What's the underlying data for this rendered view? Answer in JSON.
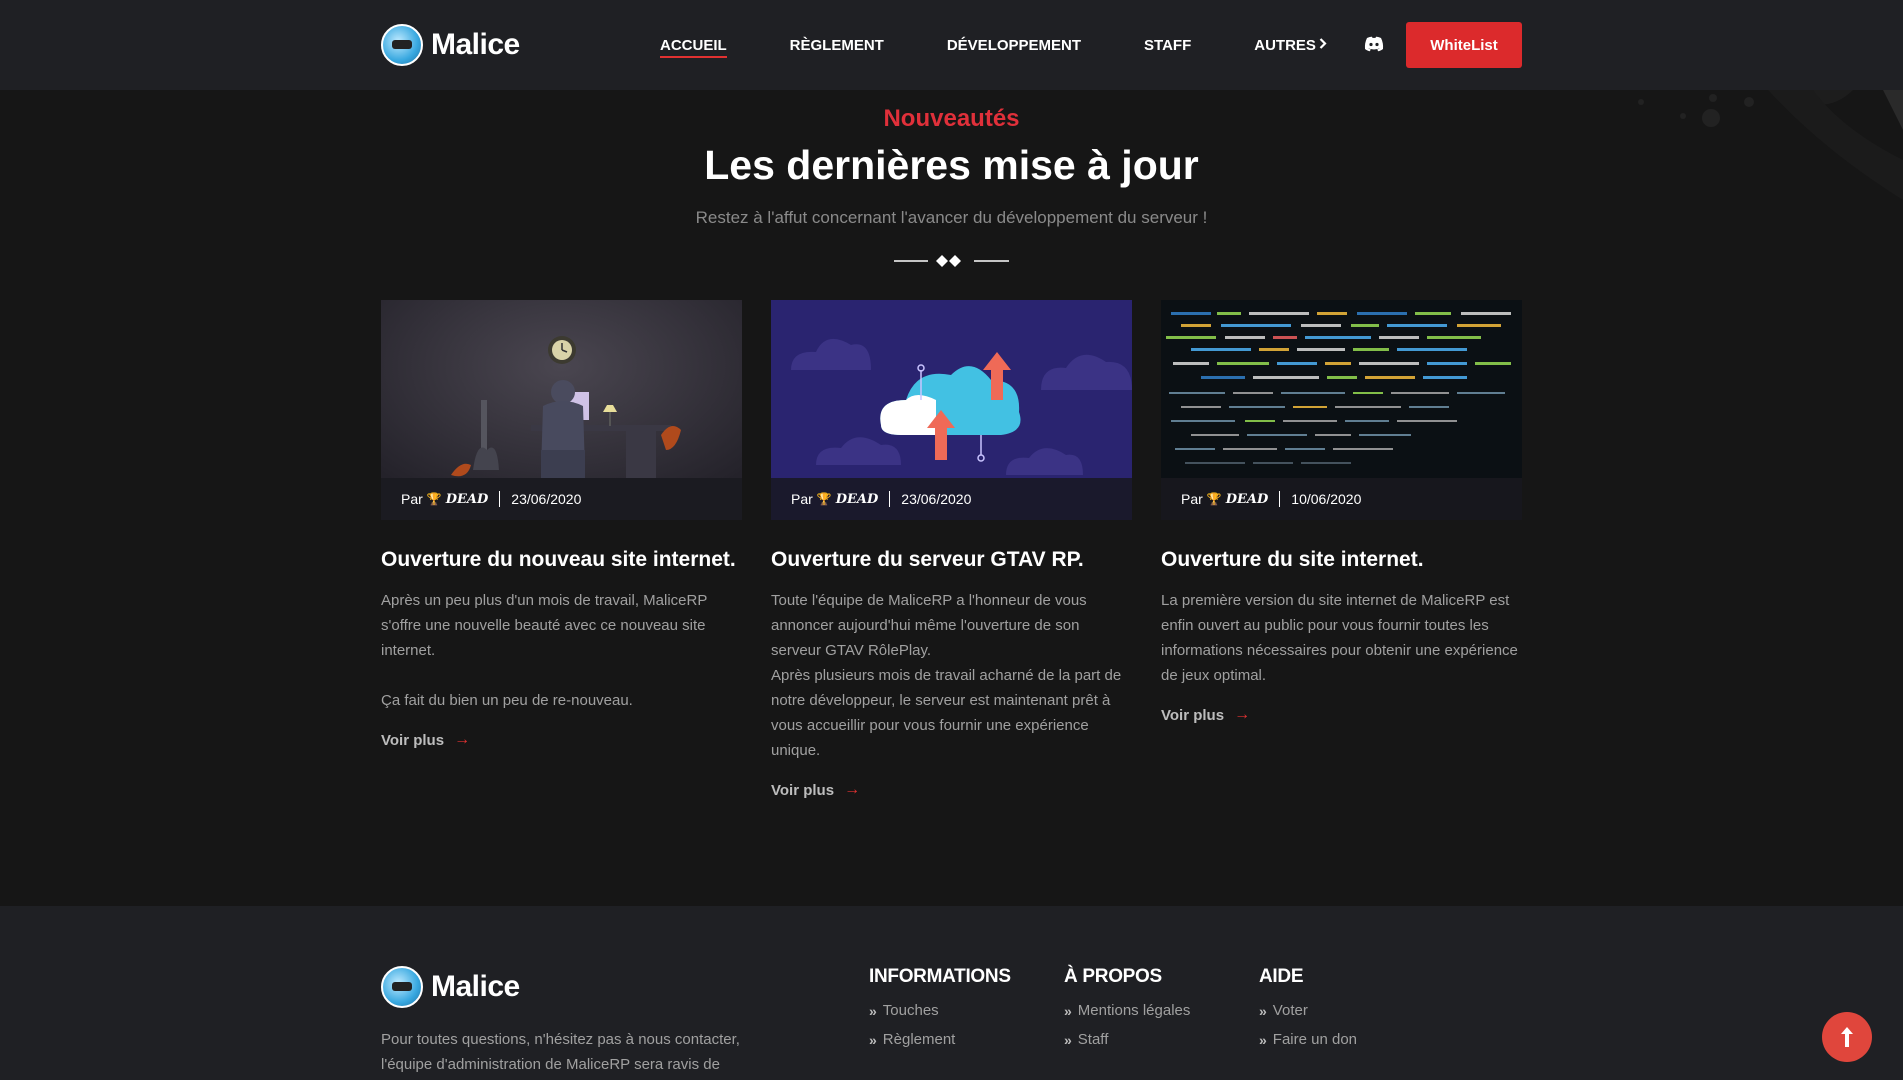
{
  "brand": {
    "name": "Malice"
  },
  "nav": {
    "items": [
      {
        "label": "ACCUEIL",
        "active": true
      },
      {
        "label": "RÈGLEMENT"
      },
      {
        "label": "DÉVELOPPEMENT"
      },
      {
        "label": "STAFF"
      },
      {
        "label": "AUTRES"
      }
    ],
    "discord_icon": "discord-icon",
    "whitelist_label": "WhiteList"
  },
  "section": {
    "kicker": "Nouveautés",
    "title": "Les dernières mise à jour",
    "subtitle": "Restez à l'affut concernant l'avancer du développement du serveur !"
  },
  "cards": [
    {
      "by": "Par",
      "author": "DEAD",
      "date": "23/06/2020",
      "title": "Ouverture du nouveau site internet.",
      "body": [
        "Après un peu plus d'un mois de travail, MaliceRP s'offre une nouvelle beauté avec ce nouveau site internet.",
        "Ça fait du bien un peu de re-nouveau."
      ],
      "more": "Voir plus",
      "image": "developer-at-desk-illustration"
    },
    {
      "by": "Par",
      "author": "DEAD",
      "date": "23/06/2020",
      "title": "Ouverture du serveur GTAV RP.",
      "body": [
        "Toute l'équipe de MaliceRP a l'honneur de vous annoncer aujourd'hui même l'ouverture de son serveur GTAV RôlePlay.",
        "Après plusieurs mois de travail acharné de la part de notre développeur, le serveur est maintenant prêt à vous accueillir pour vous fournir une expérience unique."
      ],
      "more": "Voir plus",
      "image": "cloud-upload-download-illustration"
    },
    {
      "by": "Par",
      "author": "DEAD",
      "date": "10/06/2020",
      "title": "Ouverture du site internet.",
      "body": [
        "La première version du site internet de MaliceRP est enfin ouvert au public pour vous fournir toutes les informations nécessaires pour obtenir une expérience de jeux optimal."
      ],
      "more": "Voir plus",
      "image": "source-code-screen-photo"
    }
  ],
  "footer": {
    "brand": "Malice",
    "text": "Pour toutes questions, n'hésitez pas à nous contacter, l'équipe d'administration de MaliceRP sera ravis de",
    "columns": [
      {
        "title": "INFORMATIONS",
        "links": [
          "Touches",
          "Règlement"
        ]
      },
      {
        "title": "À PROPOS",
        "links": [
          "Mentions légales",
          "Staff"
        ]
      },
      {
        "title": "AIDE",
        "links": [
          "Voter",
          "Faire un don"
        ]
      }
    ]
  },
  "colors": {
    "accent": "#dc2a2c",
    "nav_bg": "#1f2024",
    "page_bg": "#161616"
  }
}
